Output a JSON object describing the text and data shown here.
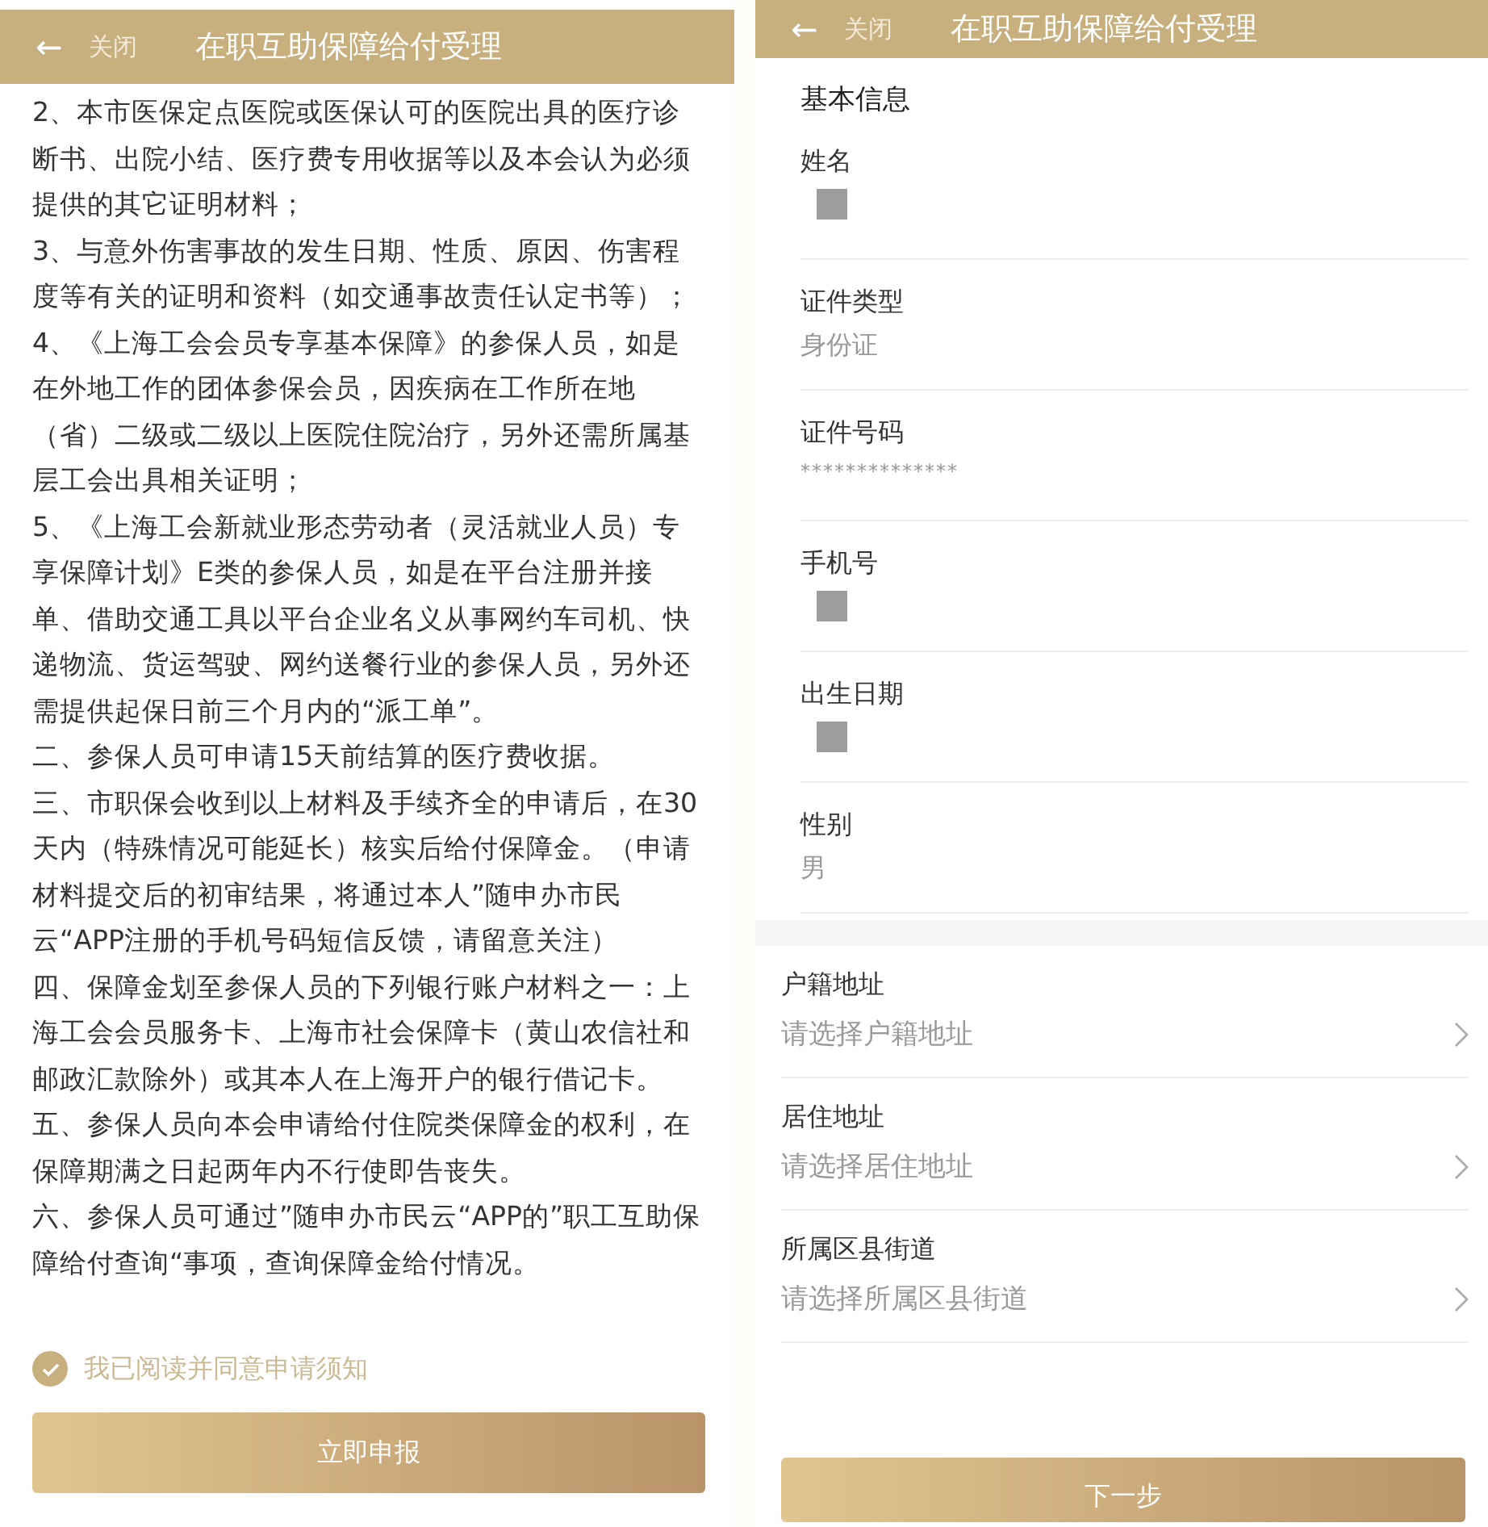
{
  "screens": [
    {
      "header": {
        "back": "←",
        "close": "关闭",
        "title": "在职互助保障给付受理"
      },
      "notice": [
        "2、本市医保定点医院或医保认可的医院出具的医疗诊断书、出院小结、医疗费专用收据等以及本会认为必须提供的其它证明材料；",
        "3、与意外伤害事故的发生日期、性质、原因、伤害程度等有关的证明和资料（如交通事故责任认定书等）；",
        "4、《上海工会会员专享基本保障》的参保人员，如是在外地工作的团体参保会员，因疾病在工作所在地（省）二级或二级以上医院住院治疗，另外还需所属基层工会出具相关证明；",
        "5、《上海工会新就业形态劳动者（灵活就业人员）专享保障计划》E类的参保人员，如是在平台注册并接单、借助交通工具以平台企业名义从事网约车司机、快递物流、货运驾驶、网约送餐行业的参保人员，另外还需提供起保日前三个月内的“派工单”。",
        "二、参保人员可申请15天前结算的医疗费收据。",
        "三、市职保会收到以上材料及手续齐全的申请后，在30天内（特殊情况可能延长）核实后给付保障金。（申请材料提交后的初审结果，将通过本人”随申办市民云“APP注册的手机号码短信反馈，请留意关注）",
        "四、保障金划至参保人员的下列银行账户材料之一：上海工会会员服务卡、上海市社会保障卡（黄山农信社和邮政汇款除外）或其本人在上海开户的银行借记卡。",
        "五、参保人员向本会申请给付住院类保障金的权利，在保障期满之日起两年内不行使即告丧失。",
        "六、参保人员可通过”随申办市民云“APP的”职工互助保障给付查询“事项，查询保障金给付情况。"
      ],
      "agree": {
        "label": "我已阅读并同意申请须知",
        "checked": true
      },
      "button": "立即申报"
    },
    {
      "header": {
        "back": "←",
        "close": "关闭",
        "title": "在职互助保障给付受理"
      },
      "section": "基本信息",
      "fields": [
        {
          "label": "姓名",
          "redacted": true
        },
        {
          "label": "证件类型",
          "value": "身份证",
          "redacted": false
        },
        {
          "label": "证件号码",
          "value": "**************",
          "redacted": false
        },
        {
          "label": "手机号",
          "redacted": true
        },
        {
          "label": "出生日期",
          "redacted": true
        },
        {
          "label": "性别",
          "value": "男",
          "redacted": false
        }
      ],
      "pickers": [
        {
          "label": "户籍地址",
          "placeholder": "请选择户籍地址"
        },
        {
          "label": "居住地址",
          "placeholder": "请选择居住地址"
        },
        {
          "label": "所属区县街道",
          "placeholder": "请选择所属区县街道"
        }
      ],
      "button": "下一步"
    }
  ]
}
